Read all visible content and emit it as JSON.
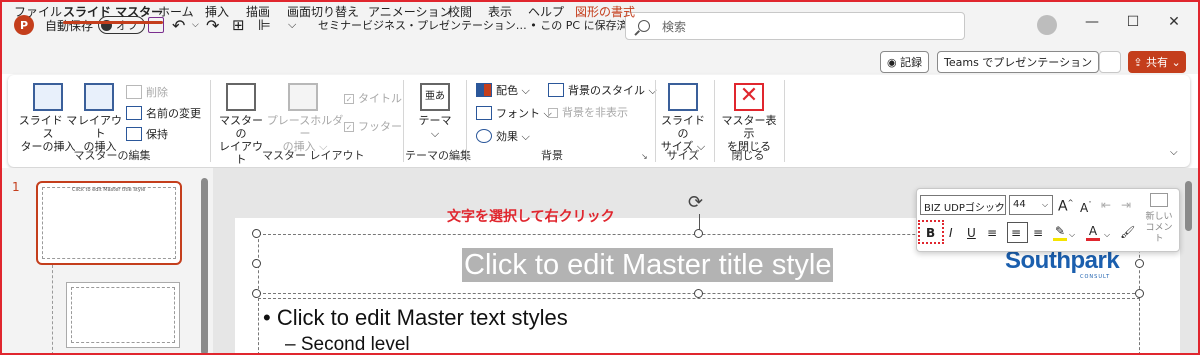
{
  "titlebar": {
    "logo": "P",
    "autosave_label": "自動保存",
    "autosave_state": "オフ",
    "doc_title": "セミナービジネス・プレゼンテーション… • この PC に保存済み ⌵",
    "search_placeholder": "検索",
    "min": "—",
    "max": "☐",
    "close": "✕"
  },
  "menu": {
    "tabs": [
      "ファイル",
      "スライド マスター",
      "ホーム",
      "挿入",
      "描画",
      "画面切り替え",
      "アニメーション",
      "校閲",
      "表示",
      "ヘルプ",
      "図形の書式"
    ],
    "record": "◉ 記録",
    "teams": "Teams でプレゼンテーション",
    "share": "⇪ 共有 ⌄"
  },
  "ribbon": {
    "insert_master": "スライド マス\nターの挿入",
    "insert_layout": "レイアウト\nの挿入",
    "delete": "削除",
    "rename": "名前の変更",
    "preserve": "保持",
    "group_master_edit": "マスターの編集",
    "master_layout": "マスターの\nレイアウト",
    "insert_placeholder": "プレースホルダー\nの挿入 ⌵",
    "title_check": "タイトル",
    "footer_check": "フッター",
    "group_master_layout": "マスター レイアウト",
    "theme": "テーマ\n⌵",
    "group_theme_edit": "テーマの編集",
    "colors": "配色 ⌵",
    "fonts": "フォント ⌵",
    "effects": "効果 ⌵",
    "bg_style": "背景のスタイル ⌵",
    "hide_bg": "背景を非表示",
    "group_background": "背景",
    "slide_size": "スライドの\nサイズ ⌵",
    "group_size": "サイズ",
    "close_master": "マスター表示\nを閉じる",
    "group_close": "閉じる"
  },
  "panel": {
    "slide_number": "1",
    "thumb_title": "Click to edit Master title style"
  },
  "slide": {
    "title": "Click to edit Master title style",
    "body1": "• Click to edit Master text styles",
    "body2": "– Second level",
    "brand": "Southpark",
    "brand_sub": "CONSULT"
  },
  "annotation": "文字を選択して右クリック",
  "mini_toolbar": {
    "font": "BIZ UDPゴシック",
    "size": "44",
    "bold": "B",
    "italic": "I",
    "underline": "U",
    "new_comment": "新しい\nコメント"
  },
  "colors": {
    "accent": "#c43e1c",
    "annotation_red": "#e0262e",
    "brand_blue": "#1b5fae"
  }
}
